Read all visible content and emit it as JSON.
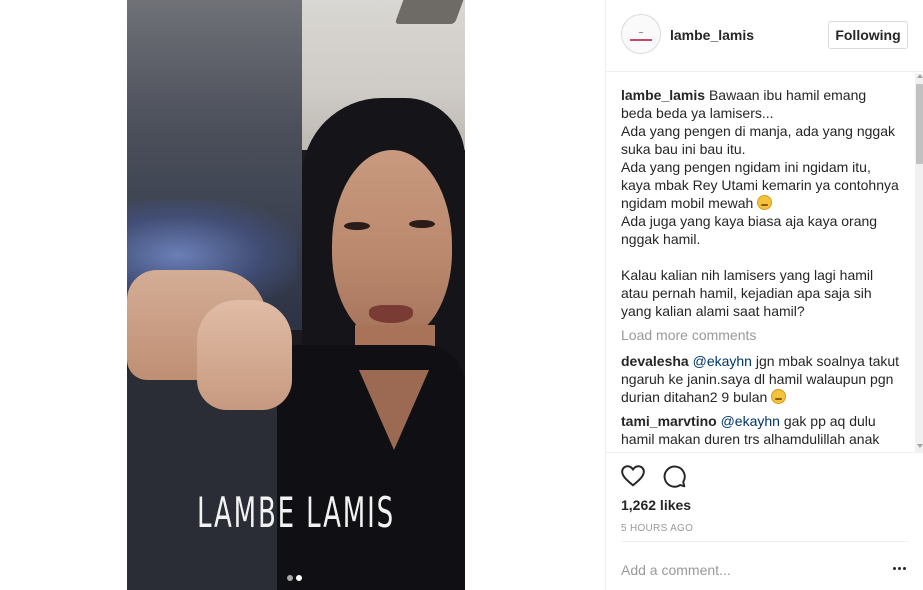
{
  "post": {
    "username": "lambe_lamis",
    "follow_label": "Following",
    "watermark": "LAMBE LAMIS",
    "caption_user": "lambe_lamis",
    "caption_text": " Bawaan ibu hamil emang beda beda ya lamisers...\nAda yang pengen di manja, ada yang nggak suka bau ini bau itu.\nAda yang pengen ngidam ini ngidam itu, kaya mbak Rey Utami kemarin ya contohnya ngidam mobil mewah ",
    "caption_text_2": "\nAda juga yang kaya biasa aja kaya orang nggak hamil.\n\nKalau kalian nih lamisers yang lagi hamil atau pernah hamil, kejadian apa saja sih yang kalian alami saat hamil?",
    "load_more": "Load more comments",
    "comments": [
      {
        "user": "devalesha",
        "mention": "@ekayhn",
        "text": " jgn mbak soalnya takut ngaruh ke janin.saya dl hamil walaupun pgn durian ditahan2 9 bulan "
      },
      {
        "user": "tami_marvtino",
        "mention": "@ekayhn",
        "text": " gak pp aq dulu hamil makan duren trs alhamdulillah anak"
      }
    ],
    "likes": "1,262 likes",
    "time_ago": "5 HOURS AGO",
    "add_comment_placeholder": "Add a comment...",
    "icons": {
      "like": "heart-icon",
      "comment": "comment-bubble-icon",
      "more": "more-options-icon",
      "emoji": "grinning-emoji-icon"
    },
    "carousel": {
      "total": 2,
      "active": 2
    }
  }
}
